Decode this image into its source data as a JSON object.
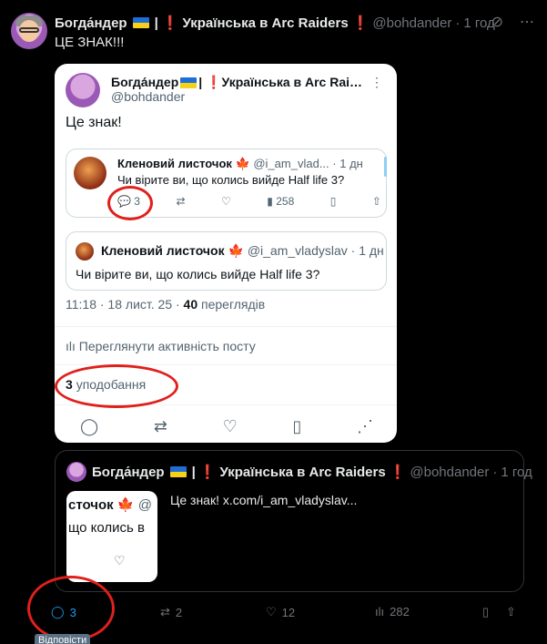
{
  "post": {
    "author_name": "Богда́ндер",
    "author_suffix": "Українська в Arc Raiders",
    "handle": "@bohdander",
    "time": "1 год",
    "text": "ЦЕ ЗНАК!!!"
  },
  "screenshot": {
    "author_name": "Богда́ндер",
    "author_suffix": "Українська в Arc Raid...",
    "handle": "@bohdander",
    "text": "Це знак!",
    "reply_card": {
      "name": "Кленовий листочок",
      "handle": "@i_am_vlad...",
      "time": "1 дн",
      "text": "Чи віритe ви, що колись вийде Half life 3?",
      "replies": "3",
      "views": "258"
    },
    "quoted_card": {
      "name": "Кленовий листочок",
      "handle": "@i_am_vladyslav",
      "time": "1 дн",
      "text": "Чи віритe ви, що колись вийде Half life 3?"
    },
    "meta_time": "11:18 · 18 лист. 25 ·",
    "meta_views": "40",
    "meta_views_label": "переглядів",
    "activity": "Переглянути активність посту",
    "likes_count": "3",
    "likes_label": "уподобання"
  },
  "quote": {
    "author_name": "Богда́ндер",
    "author_suffix": "Українська в Arc Raiders",
    "handle": "@bohdander",
    "time": "1 год",
    "thumb_line1": "сточок",
    "thumb_handle": "@",
    "thumb_line2": "що колись в",
    "text": "Це знак!  x.com/i_am_vladyslav..."
  },
  "actions": {
    "replies": "3",
    "reposts": "2",
    "likes": "12",
    "views": "282",
    "tooltip": "Відповісти"
  }
}
